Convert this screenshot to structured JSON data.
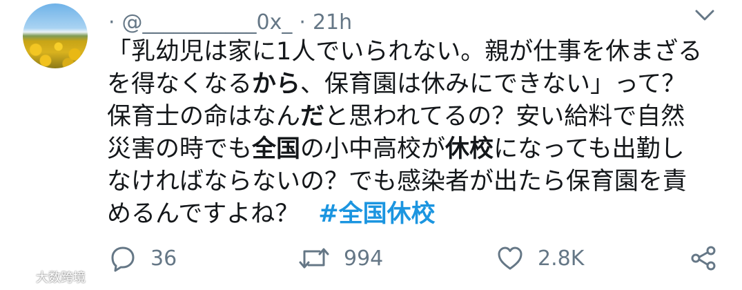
{
  "tweet": {
    "lead_dot": "·",
    "handle": "@___________0x_",
    "separator": "·",
    "time": "21h",
    "lines": [
      {
        "a": "「乳幼児は家に1人でいられない。親が仕事を休まざる"
      },
      {
        "a": "を得なくなる",
        "b": "から",
        "c": "、保育園は休みにできない」って？"
      },
      {
        "a": "保育士の命はなん",
        "b": "だ",
        "c": "と思われてるの？安い給料で自然"
      },
      {
        "a": "災害の時でも",
        "b": "全国",
        "c": "の小中高校が",
        "d": "休校",
        "e": "になっても出勤し"
      },
      {
        "a": "なければならないの？でも感染者が出たら保育園を責"
      },
      {
        "a": "めるんですよね？"
      }
    ],
    "hashtag": "#全国休校"
  },
  "actions": {
    "reply_count": "36",
    "retweet_count": "994",
    "like_count": "2.8K"
  },
  "watermark": {
    "text": "大数跨境"
  },
  "icons": {
    "avatar": "sunflower-field-avatar",
    "menu": "chevron-down-icon",
    "reply": "reply-icon",
    "retweet": "retweet-icon",
    "like": "heart-icon",
    "share": "share-icon"
  },
  "colors": {
    "text": "#14171a",
    "muted": "#657786",
    "link": "#1b95e0",
    "background": "#ffffff"
  }
}
